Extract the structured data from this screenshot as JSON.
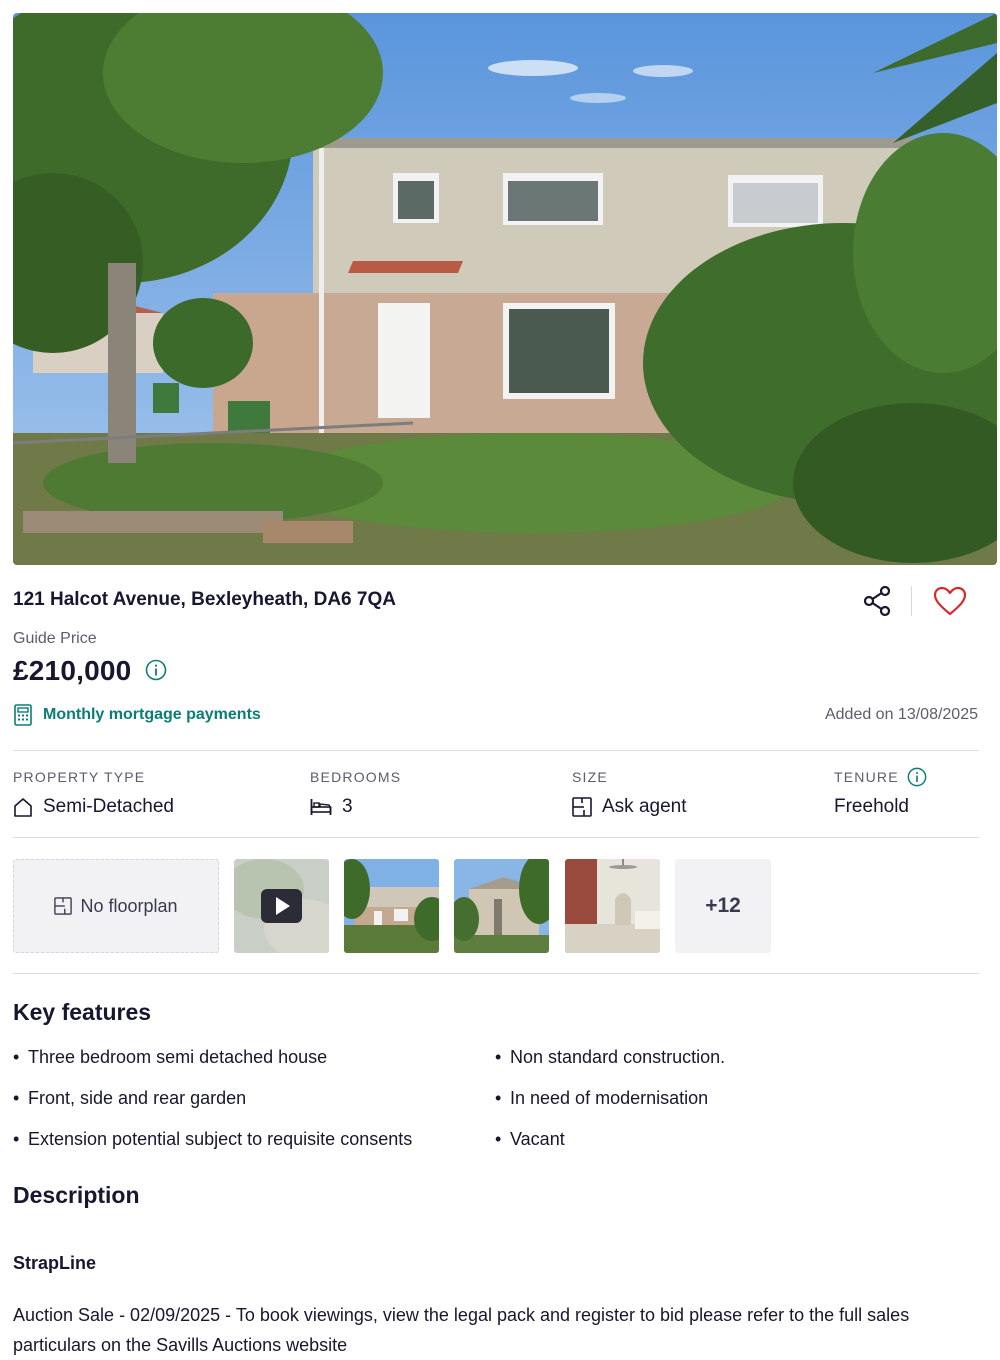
{
  "listing": {
    "address": "121 Halcot Avenue, Bexleyheath, DA6 7QA",
    "price_label": "Guide Price",
    "price": "£210,000",
    "mortgage_link": "Monthly mortgage payments",
    "added": "Added on 13/08/2025"
  },
  "stats": {
    "property_type": {
      "label": "PROPERTY TYPE",
      "value": "Semi-Detached",
      "icon": "house-icon"
    },
    "bedrooms": {
      "label": "BEDROOMS",
      "value": "3",
      "icon": "bed-icon"
    },
    "size": {
      "label": "SIZE",
      "value": "Ask agent",
      "icon": "floorplan-icon"
    },
    "tenure": {
      "label": "TENURE",
      "value": "Freehold",
      "icon": "info-icon"
    }
  },
  "media": {
    "floorplan_label": "No floorplan",
    "more_count": "+12"
  },
  "key_features": {
    "heading": "Key features",
    "items": [
      "Three bedroom semi detached house",
      "Front, side and rear garden",
      "Extension potential subject to requisite consents",
      "Non standard construction.",
      "In need of modernisation",
      "Vacant"
    ]
  },
  "description": {
    "heading": "Description",
    "strapline": "StrapLine",
    "text": "Auction Sale - 02/09/2025 - To book viewings, view the legal pack and register to bid please refer to the full sales particulars on the Savills Auctions website"
  },
  "colors": {
    "accent_teal": "#0a7e76",
    "heart_red": "#d42a2a",
    "text_dark": "#17172f",
    "text_muted": "#5c5c6e"
  }
}
